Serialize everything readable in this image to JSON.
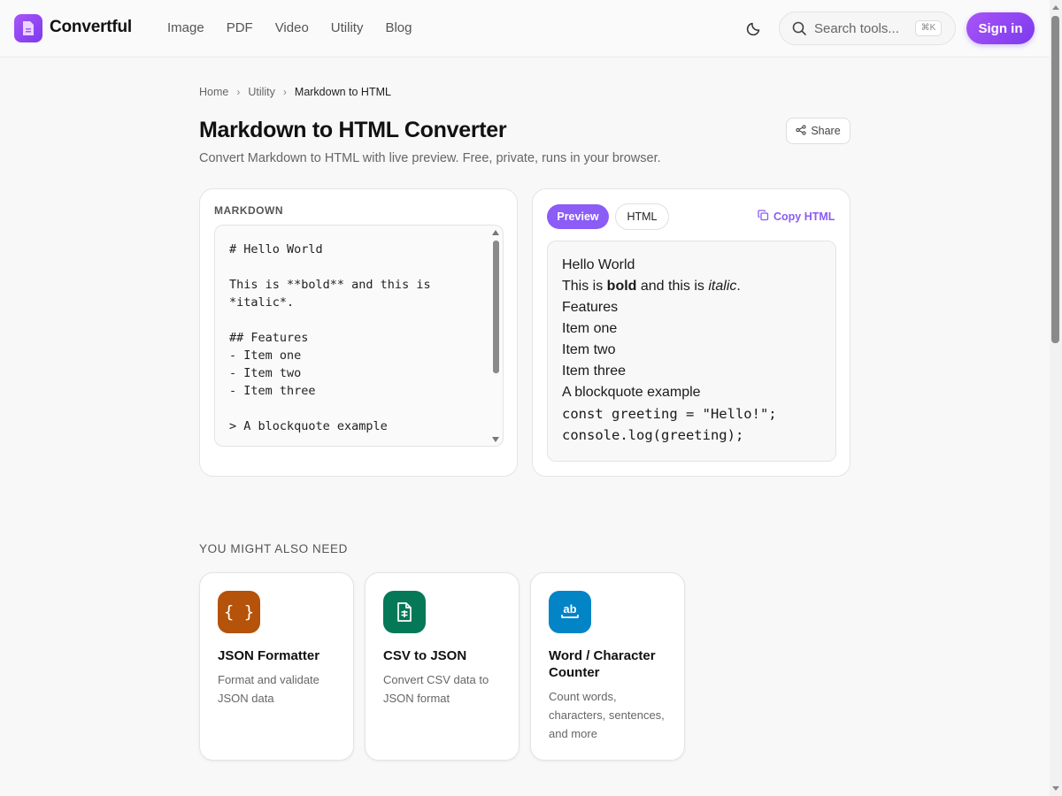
{
  "header": {
    "brand": "Convertful",
    "nav": [
      "Image",
      "PDF",
      "Video",
      "Utility",
      "Blog"
    ],
    "search_placeholder": "Search tools...",
    "search_shortcut": "⌘K",
    "signin_label": "Sign in",
    "accent": "#8b5cf6"
  },
  "breadcrumb": [
    "Home",
    "Utility",
    "Markdown to HTML"
  ],
  "page": {
    "title": "Markdown to HTML Converter",
    "subtitle": "Convert Markdown to HTML with live preview. Free, private, runs in your browser.",
    "share_label": "Share"
  },
  "editor": {
    "label": "MARKDOWN",
    "content": "# Hello World\n\nThis is **bold** and this is\n*italic*.\n\n## Features\n- Item one\n- Item two\n- Item three\n\n> A blockquote example"
  },
  "preview": {
    "tabs": [
      "Preview",
      "HTML"
    ],
    "copy_label": "Copy HTML",
    "line1": "Hello World",
    "line2_pre": "This is ",
    "line2_bold": "bold",
    "line2_mid": " and this is ",
    "line2_italic": "italic",
    "line2_post": ".",
    "line3": "Features",
    "line4": "Item one",
    "line5": "Item two",
    "line6": "Item three",
    "line7": "A blockquote example",
    "line8": "const greeting = \"Hello!\";",
    "line9": "console.log(greeting);"
  },
  "related": {
    "title": "YOU MIGHT ALSO NEED",
    "cards": [
      {
        "title": "JSON Formatter",
        "desc": "Format and validate JSON data",
        "icon": "braces-icon",
        "color": "#b45309"
      },
      {
        "title": "CSV to JSON",
        "desc": "Convert CSV data to JSON format",
        "icon": "file-sheet-icon",
        "color": "#047857"
      },
      {
        "title": "Word / Character Counter",
        "desc": "Count words, characters, sentences, and more",
        "icon": "ab-text-icon",
        "color": "#0284c7"
      }
    ]
  }
}
